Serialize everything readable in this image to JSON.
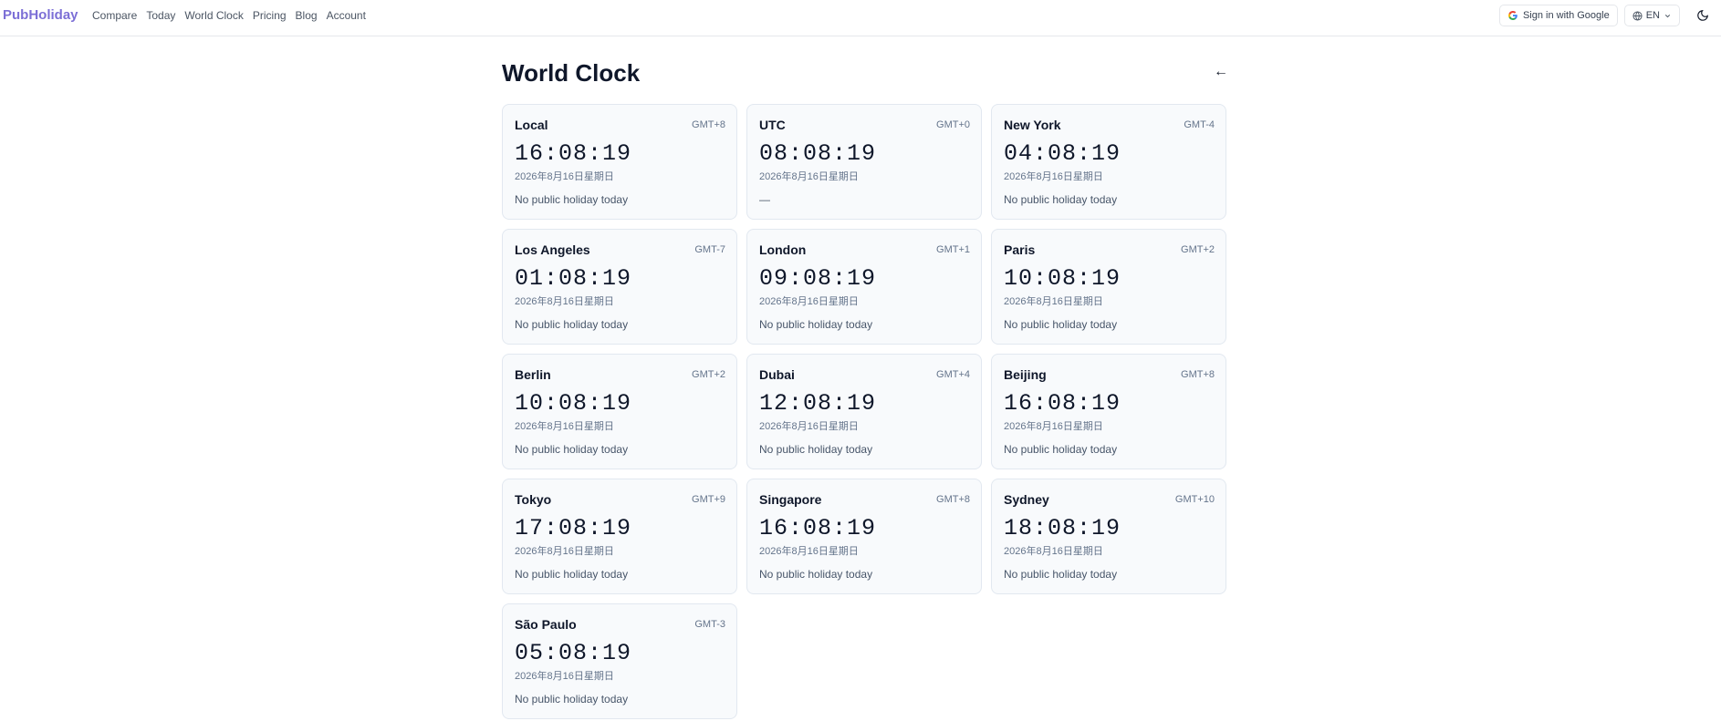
{
  "header": {
    "brand": "PubHoliday",
    "nav": [
      "Compare",
      "Today",
      "World Clock",
      "Pricing",
      "Blog",
      "Account"
    ],
    "sign_in_label": "Sign in with Google",
    "language": "EN"
  },
  "main": {
    "title": "World Clock",
    "back_symbol": "←",
    "clocks": [
      {
        "city": "Local",
        "offset": "GMT+8",
        "time": "16:08:19",
        "date": "2026年8月16日星期日",
        "holiday": "No public holiday today"
      },
      {
        "city": "UTC",
        "offset": "GMT+0",
        "time": "08:08:19",
        "date": "2026年8月16日星期日",
        "holiday": "—"
      },
      {
        "city": "New York",
        "offset": "GMT-4",
        "time": "04:08:19",
        "date": "2026年8月16日星期日",
        "holiday": "No public holiday today"
      },
      {
        "city": "Los Angeles",
        "offset": "GMT-7",
        "time": "01:08:19",
        "date": "2026年8月16日星期日",
        "holiday": "No public holiday today"
      },
      {
        "city": "London",
        "offset": "GMT+1",
        "time": "09:08:19",
        "date": "2026年8月16日星期日",
        "holiday": "No public holiday today"
      },
      {
        "city": "Paris",
        "offset": "GMT+2",
        "time": "10:08:19",
        "date": "2026年8月16日星期日",
        "holiday": "No public holiday today"
      },
      {
        "city": "Berlin",
        "offset": "GMT+2",
        "time": "10:08:19",
        "date": "2026年8月16日星期日",
        "holiday": "No public holiday today"
      },
      {
        "city": "Dubai",
        "offset": "GMT+4",
        "time": "12:08:19",
        "date": "2026年8月16日星期日",
        "holiday": "No public holiday today"
      },
      {
        "city": "Beijing",
        "offset": "GMT+8",
        "time": "16:08:19",
        "date": "2026年8月16日星期日",
        "holiday": "No public holiday today"
      },
      {
        "city": "Tokyo",
        "offset": "GMT+9",
        "time": "17:08:19",
        "date": "2026年8月16日星期日",
        "holiday": "No public holiday today"
      },
      {
        "city": "Singapore",
        "offset": "GMT+8",
        "time": "16:08:19",
        "date": "2026年8月16日星期日",
        "holiday": "No public holiday today"
      },
      {
        "city": "Sydney",
        "offset": "GMT+10",
        "time": "18:08:19",
        "date": "2026年8月16日星期日",
        "holiday": "No public holiday today"
      },
      {
        "city": "São Paulo",
        "offset": "GMT-3",
        "time": "05:08:19",
        "date": "2026年8月16日星期日",
        "holiday": "No public holiday today"
      }
    ]
  },
  "colors": {
    "brand": "#7c6fd6",
    "card_bg": "#f8fafc",
    "card_border": "#e2e8f0"
  }
}
